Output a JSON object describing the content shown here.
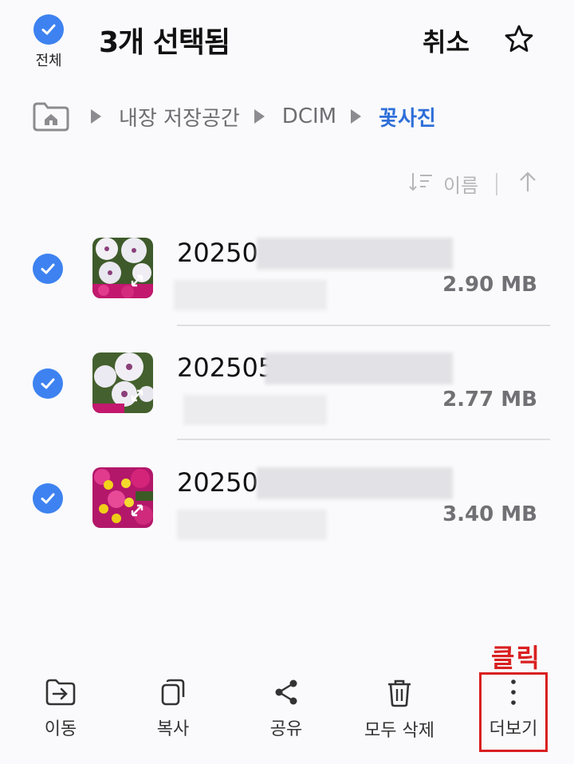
{
  "header": {
    "select_all_label": "전체",
    "title": "3개 선택됨",
    "cancel_label": "취소"
  },
  "breadcrumb": {
    "items": [
      "내장 저장공간",
      "DCIM"
    ],
    "current": "꽃사진"
  },
  "sort": {
    "label": "이름"
  },
  "files": [
    {
      "name": "20250",
      "size": "2.90 MB",
      "checked": true
    },
    {
      "name": "202505",
      "size": "2.77 MB",
      "checked": true
    },
    {
      "name": "20250",
      "size": "3.40 MB",
      "checked": true
    }
  ],
  "bottom_bar": {
    "move": "이동",
    "copy": "복사",
    "share": "공유",
    "delete_all": "모두 삭제",
    "more": "더보기"
  },
  "annotation": {
    "click_label": "클릭"
  },
  "colors": {
    "accent": "#3d82f0",
    "breadcrumb_current": "#2f6fd9",
    "annotation": "#d92020"
  }
}
